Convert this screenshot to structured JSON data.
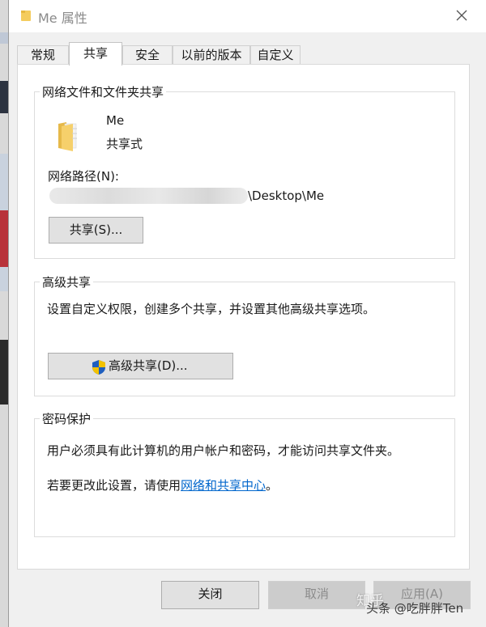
{
  "window": {
    "title": "Me 属性"
  },
  "tabs": [
    {
      "label": "常规"
    },
    {
      "label": "共享"
    },
    {
      "label": "安全"
    },
    {
      "label": "以前的版本"
    },
    {
      "label": "自定义"
    }
  ],
  "network_sharing": {
    "group_label": "网络文件和文件夹共享",
    "folder_name": "Me",
    "share_status": "共享式",
    "path_label": "网络路径(N):",
    "path_suffix": "\\Desktop\\Me",
    "share_button": "共享(S)..."
  },
  "advanced_sharing": {
    "group_label": "高级共享",
    "description": "设置自定义权限，创建多个共享，并设置其他高级共享选项。",
    "button": "高级共享(D)..."
  },
  "password_protection": {
    "group_label": "密码保护",
    "description": "用户必须具有此计算机的用户帐户和密码，才能访问共享文件夹。",
    "change_prefix": "若要更改此设置，请使用",
    "link": "网络和共享中心",
    "change_suffix": "。"
  },
  "footer": {
    "close_button": "关闭",
    "cancel_button": "取消",
    "apply_button": "应用(A)"
  },
  "watermark": {
    "line1": "知乎",
    "line2": "头条 @吃胖胖Ten"
  },
  "colors": {
    "link": "#0066cc",
    "shield_blue": "#1f5fbf",
    "shield_yellow": "#f2c200",
    "folder": "#f4cc5e"
  }
}
